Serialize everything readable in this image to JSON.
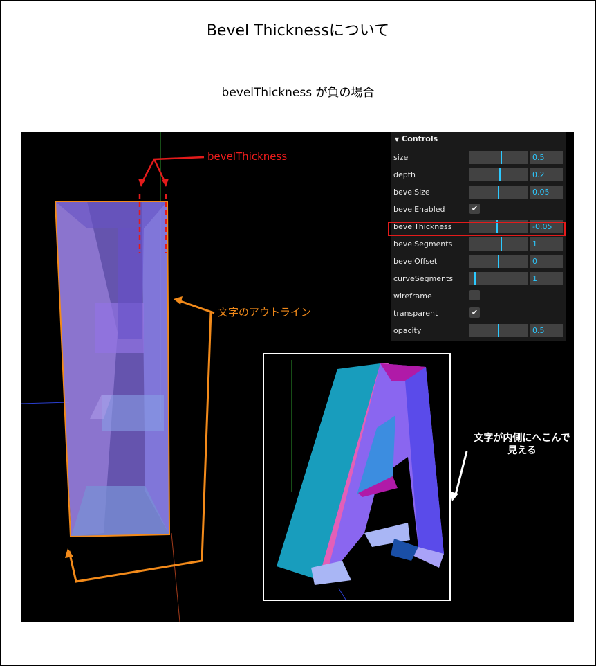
{
  "page": {
    "title": "Bevel Thicknessについて",
    "subtitle": "bevelThickness が負の場合"
  },
  "controls": {
    "header": "Controls",
    "rows": [
      {
        "label": "size",
        "type": "slider",
        "value": "0.5",
        "fraction": 0.55
      },
      {
        "label": "depth",
        "type": "slider",
        "value": "0.2",
        "fraction": 0.53
      },
      {
        "label": "bevelSize",
        "type": "slider",
        "value": "0.05",
        "fraction": 0.5
      },
      {
        "label": "bevelEnabled",
        "type": "checkbox",
        "checked": true
      },
      {
        "label": "bevelThickness",
        "type": "slider",
        "value": "-0.05",
        "fraction": 0.48
      },
      {
        "label": "bevelSegments",
        "type": "slider",
        "value": "1",
        "fraction": 0.55
      },
      {
        "label": "bevelOffset",
        "type": "slider",
        "value": "0",
        "fraction": 0.5
      },
      {
        "label": "curveSegments",
        "type": "slider",
        "value": "1",
        "fraction": 0.08
      },
      {
        "label": "wireframe",
        "type": "checkbox",
        "checked": false
      },
      {
        "label": "transparent",
        "type": "checkbox",
        "checked": true
      },
      {
        "label": "opacity",
        "type": "slider",
        "value": "0.5",
        "fraction": 0.5
      }
    ]
  },
  "annotations": {
    "bevel_thickness": "bevelThickness",
    "outline": "文字のアウトライン",
    "concave": "文字が内側にへこんで見える"
  },
  "colors": {
    "highlight_red": "#e31b1b",
    "annotation_orange": "#f28a1a",
    "slider_accent": "#2cc9ff"
  }
}
